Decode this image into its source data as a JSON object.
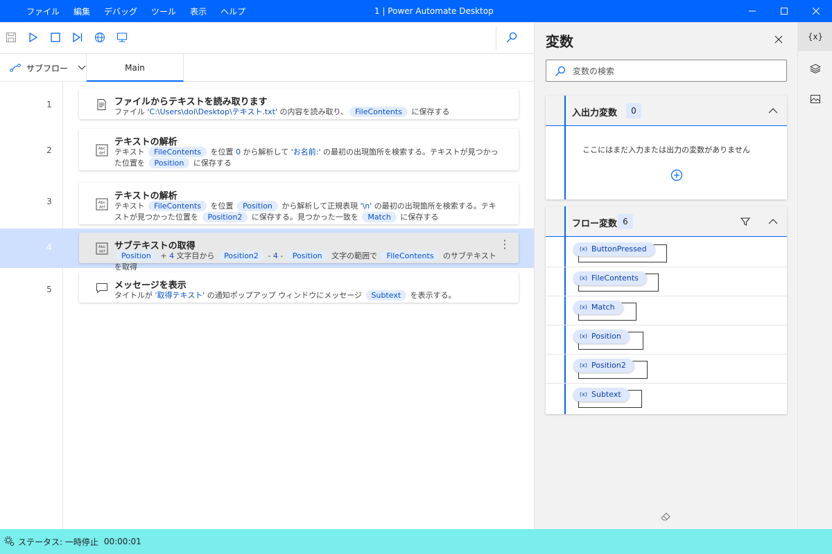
{
  "menu": [
    "ファイル",
    "編集",
    "デバッグ",
    "ツール",
    "表示",
    "ヘルプ"
  ],
  "window_title": "1 | Power Automate Desktop",
  "subflow_label": "サブフロー",
  "tab_main": "Main",
  "actions": [
    {
      "line": "1",
      "icon": "file-text-icon",
      "title": "ファイルからテキストを読み取ります",
      "desc": [
        {
          "t": "text",
          "v": "ファイル "
        },
        {
          "t": "lit",
          "v": "'C:\\Users\\doi\\Desktop\\テキスト.txt'"
        },
        {
          "t": "text",
          "v": " の内容を読み取り、"
        },
        {
          "t": "chip",
          "v": "FileContents"
        },
        {
          "t": "text",
          "v": " に保存する"
        }
      ]
    },
    {
      "line": "2",
      "icon": "abc-def-icon",
      "title": "テキストの解析",
      "desc": [
        {
          "t": "text",
          "v": "テキスト "
        },
        {
          "t": "chip",
          "v": "FileContents"
        },
        {
          "t": "text",
          "v": " を位置 "
        },
        {
          "t": "lit",
          "v": "0"
        },
        {
          "t": "text",
          "v": " から解析して "
        },
        {
          "t": "lit",
          "v": "'お名前:'"
        },
        {
          "t": "text",
          "v": " の最初の出現箇所を検索する。テキストが見つかった位置を "
        },
        {
          "t": "chip",
          "v": "Position"
        },
        {
          "t": "text",
          "v": " に保存する"
        }
      ]
    },
    {
      "line": "3",
      "icon": "abc-def-icon",
      "title": "テキストの解析",
      "desc": [
        {
          "t": "text",
          "v": "テキスト "
        },
        {
          "t": "chip",
          "v": "FileContents"
        },
        {
          "t": "text",
          "v": " を位置 "
        },
        {
          "t": "chip",
          "v": "Position"
        },
        {
          "t": "text",
          "v": " から解析して正規表現 "
        },
        {
          "t": "lit",
          "v": "'\\n'"
        },
        {
          "t": "text",
          "v": " の最初の出現箇所を検索する。テキストが見つかった位置を "
        },
        {
          "t": "chip",
          "v": "Position2"
        },
        {
          "t": "text",
          "v": " に保存する。見つかった一致を "
        },
        {
          "t": "chip",
          "v": "Match"
        },
        {
          "t": "text",
          "v": " に保存する"
        }
      ]
    },
    {
      "line": "4",
      "icon": "abc-def-icon",
      "title": "サブテキストの取得",
      "selected": true,
      "desc": [
        {
          "t": "chip",
          "v": "Position"
        },
        {
          "t": "text",
          "v": " + "
        },
        {
          "t": "lit",
          "v": "4"
        },
        {
          "t": "text",
          "v": " 文字目から "
        },
        {
          "t": "chip",
          "v": "Position2"
        },
        {
          "t": "text",
          "v": " - "
        },
        {
          "t": "lit",
          "v": "4"
        },
        {
          "t": "text",
          "v": " - "
        },
        {
          "t": "chip",
          "v": "Position"
        },
        {
          "t": "text",
          "v": " 文字の範囲で "
        },
        {
          "t": "chip",
          "v": "FileContents"
        },
        {
          "t": "text",
          "v": " のサブテキストを取得"
        }
      ]
    },
    {
      "line": "5",
      "icon": "message-icon",
      "title": "メッセージを表示",
      "desc": [
        {
          "t": "text",
          "v": "タイトルが "
        },
        {
          "t": "lit",
          "v": "'取得テキスト'"
        },
        {
          "t": "text",
          "v": " の通知ポップアップ ウィンドウにメッセージ "
        },
        {
          "t": "chip",
          "v": "Subtext"
        },
        {
          "t": "text",
          "v": " を表示する。"
        }
      ]
    }
  ],
  "status": {
    "label": "ステータス: 一時停止",
    "time": "00:00:01"
  },
  "variables_panel": {
    "title": "変数",
    "search_placeholder": "変数の検索",
    "io_section": {
      "title": "入出力変数",
      "count": "0",
      "empty_message": "ここにはまだ入力または出力の変数がありません"
    },
    "flow_section": {
      "title": "フロー変数",
      "count": "6",
      "variables": [
        "ButtonPressed",
        "FileContents",
        "Match",
        "Position",
        "Position2",
        "Subtext"
      ]
    }
  },
  "iconbar": {
    "variables_label": "{x}"
  },
  "colors": {
    "accent": "#0066ff",
    "status_bar": "#7aeded",
    "selected_row": "#cfe0ff",
    "chip_bg": "#e1ecff"
  }
}
